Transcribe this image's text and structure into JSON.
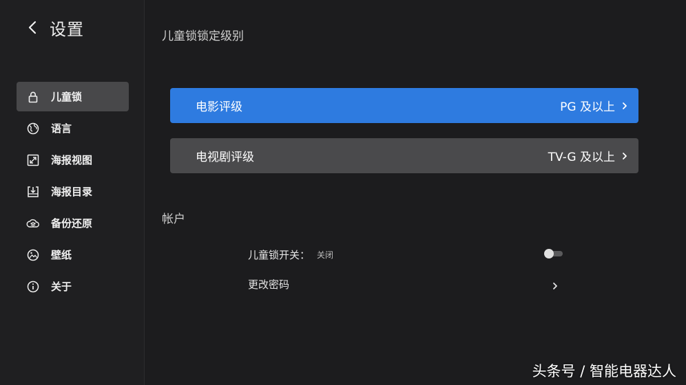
{
  "header": {
    "title": "设置"
  },
  "sidebar": {
    "items": [
      {
        "label": "儿童锁",
        "icon": "lock-icon",
        "active": true
      },
      {
        "label": "语言",
        "icon": "globe-icon",
        "active": false
      },
      {
        "label": "海报视图",
        "icon": "expand-icon",
        "active": false
      },
      {
        "label": "海报目录",
        "icon": "download-box-icon",
        "active": false
      },
      {
        "label": "备份还原",
        "icon": "cloud-layers-icon",
        "active": false
      },
      {
        "label": "壁纸",
        "icon": "image-icon",
        "active": false
      },
      {
        "label": "关于",
        "icon": "info-icon",
        "active": false
      }
    ]
  },
  "main": {
    "lock_level_title": "儿童锁锁定级别",
    "movie_rating": {
      "label": "电影评级",
      "value": "PG 及以上"
    },
    "tv_rating": {
      "label": "电视剧评级",
      "value": "TV-G 及以上"
    },
    "account_title": "帐户",
    "child_lock_switch": {
      "label": "儿童锁开关：",
      "state": "关闭"
    },
    "change_password": {
      "label": "更改密码"
    }
  },
  "watermark": "头条号 / 智能电器达人",
  "colors": {
    "accent": "#2e7be0",
    "row_gray": "#4a4a4c",
    "background": "#1c1c1e",
    "active_nav": "#48484a"
  }
}
